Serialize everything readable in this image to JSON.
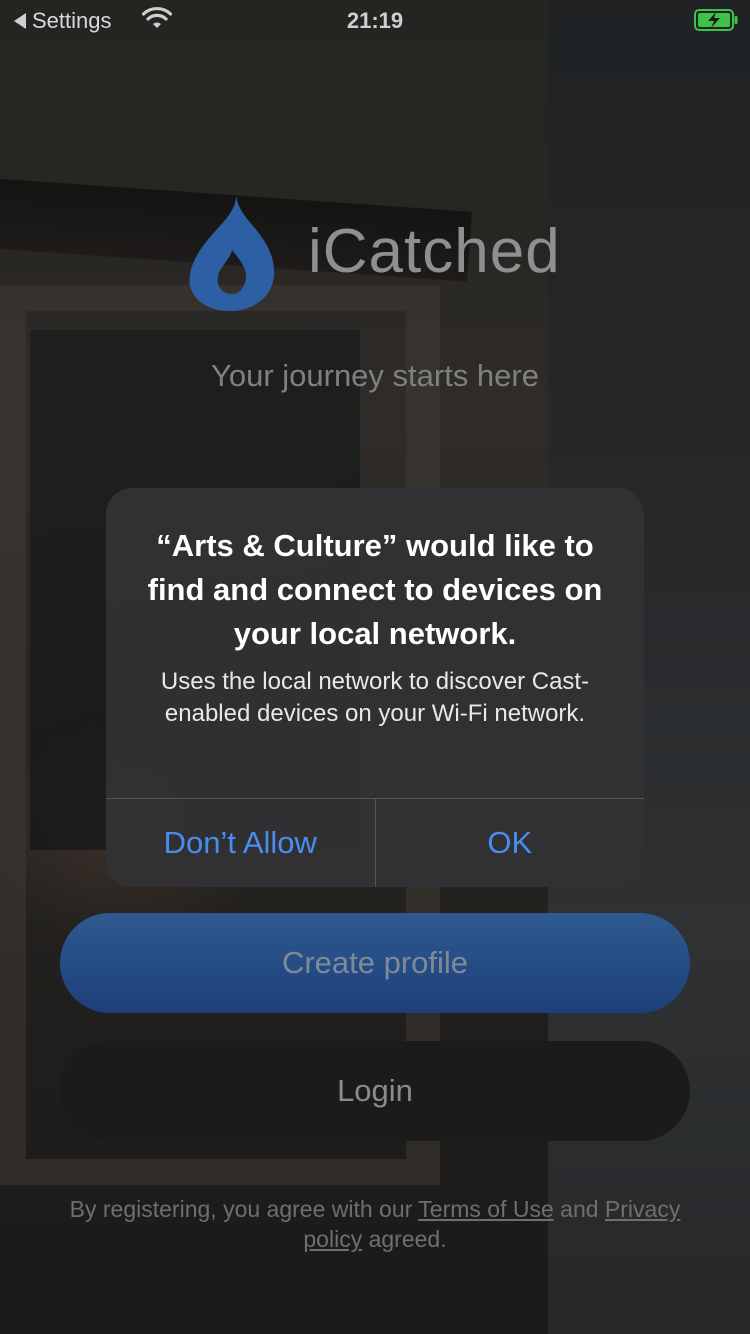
{
  "status_bar": {
    "back_label": "Settings",
    "time": "21:19"
  },
  "app": {
    "name": "iCatched",
    "tagline": "Your journey starts here",
    "create_profile_label": "Create profile",
    "login_label": "Login",
    "legal": {
      "prefix": "By registering, you agree with our",
      "terms_link": "Terms of Use",
      "middle": "and",
      "privacy_link_1": "Privacy",
      "privacy_link_2": "policy",
      "suffix": "agreed."
    }
  },
  "alert": {
    "title": "“Arts & Culture” would like to find and connect to devices on your local network.",
    "message": "Uses the local network to discover Cast-enabled devices on your Wi-Fi network.",
    "deny_label": "Don’t Allow",
    "ok_label": "OK"
  },
  "colors": {
    "accent_blue": "#4a8df0",
    "logo_blue": "#2d5fa5",
    "battery_green": "#3fc24a"
  },
  "icons": [
    "back-arrow-icon",
    "wifi-icon",
    "battery-charging-icon",
    "flame-logo-icon"
  ]
}
